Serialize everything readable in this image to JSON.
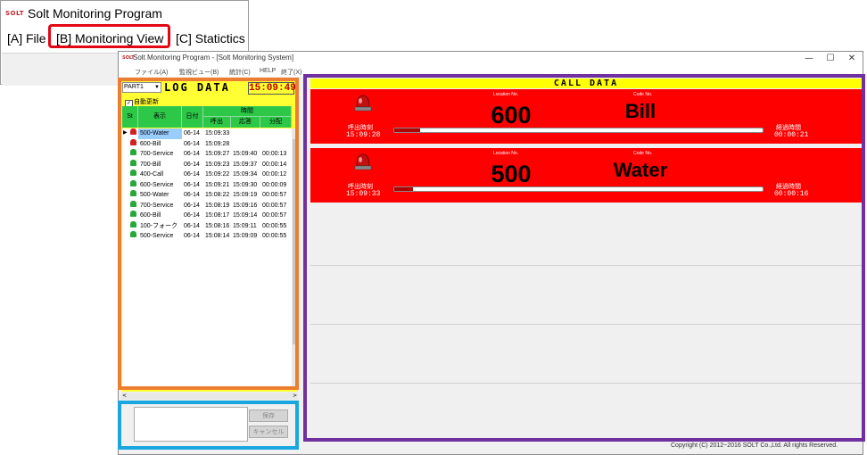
{
  "callout": {
    "logo": "SOLT",
    "title": "Solt Monitoring Program",
    "menu": [
      "[A] File",
      "[B] Monitoring View",
      "[C] Statictics"
    ]
  },
  "window": {
    "logo": "SOLT",
    "title": "Solt Monitoring Program - [Solt Monitoring System]",
    "menubar": [
      "ファイル(A)",
      "監視ビュー(B)",
      "統計(C)",
      "HELP",
      "終了(X)"
    ],
    "controls": [
      "—",
      "☐",
      "✕"
    ]
  },
  "log": {
    "part": "PART1",
    "title": "LOG DATA",
    "clock": "15:09:49",
    "auto_update": "自動更新",
    "headers": {
      "st": "St",
      "display": "表示",
      "date": "日付",
      "time": "時間",
      "call": "呼出",
      "answer": "応答",
      "split": "分配"
    },
    "rows": [
      {
        "status": "red",
        "display": "500-Water",
        "date": "06-14",
        "call": "15:09:33",
        "answer": "",
        "split": ""
      },
      {
        "status": "red",
        "display": "600-Bill",
        "date": "06-14",
        "call": "15:09:28",
        "answer": "",
        "split": ""
      },
      {
        "status": "green",
        "display": "700-Service",
        "date": "06-14",
        "call": "15:09:27",
        "answer": "15:09:40",
        "split": "00:00:13"
      },
      {
        "status": "green",
        "display": "700-Bill",
        "date": "06-14",
        "call": "15:09:23",
        "answer": "15:09:37",
        "split": "00:00:14"
      },
      {
        "status": "green",
        "display": "400-Call",
        "date": "06-14",
        "call": "15:09:22",
        "answer": "15:09:34",
        "split": "00:00:12"
      },
      {
        "status": "green",
        "display": "600-Service",
        "date": "06-14",
        "call": "15:09:21",
        "answer": "15:09:30",
        "split": "00:00:09"
      },
      {
        "status": "green",
        "display": "500-Water",
        "date": "06-14",
        "call": "15:08:22",
        "answer": "15:09:19",
        "split": "00:00:57"
      },
      {
        "status": "green",
        "display": "700-Service",
        "date": "06-14",
        "call": "15:08:19",
        "answer": "15:09:16",
        "split": "00:00:57"
      },
      {
        "status": "green",
        "display": "600-Bill",
        "date": "06-14",
        "call": "15:08:17",
        "answer": "15:09:14",
        "split": "00:00:57"
      },
      {
        "status": "green",
        "display": "100-フォーク",
        "date": "06-14",
        "call": "15:08:16",
        "answer": "15:09:11",
        "split": "00:00:55"
      },
      {
        "status": "green",
        "display": "500-Service",
        "date": "06-14",
        "call": "15:08:14",
        "answer": "15:09:09",
        "split": "00:00:55"
      }
    ]
  },
  "memo": {
    "save": "保存",
    "cancel": "キャンセル"
  },
  "call": {
    "title": "CALL DATA",
    "location_label": "Location No.",
    "code_label": "Code No.",
    "start_label": "呼出時刻",
    "elapsed_label": "経過時間",
    "rows": [
      {
        "location": "600",
        "code": "Bill",
        "start": "15:09:28",
        "elapsed": "00:00:21",
        "progress": 0.07
      },
      {
        "location": "500",
        "code": "Water",
        "start": "15:09:33",
        "elapsed": "00:00:16",
        "progress": 0.05
      }
    ]
  },
  "colors": {
    "call_active": "#ff0000",
    "header_yellow": "#ffff00",
    "log_green": "#2ec848",
    "orange": "#ed7d31",
    "blue": "#1aa7e0",
    "purple": "#7030a0",
    "menu_highlight": "#e30613"
  },
  "footer": "Copyright (C) 2012~2016 SOLT Co.,Ltd. All rights Reserved."
}
